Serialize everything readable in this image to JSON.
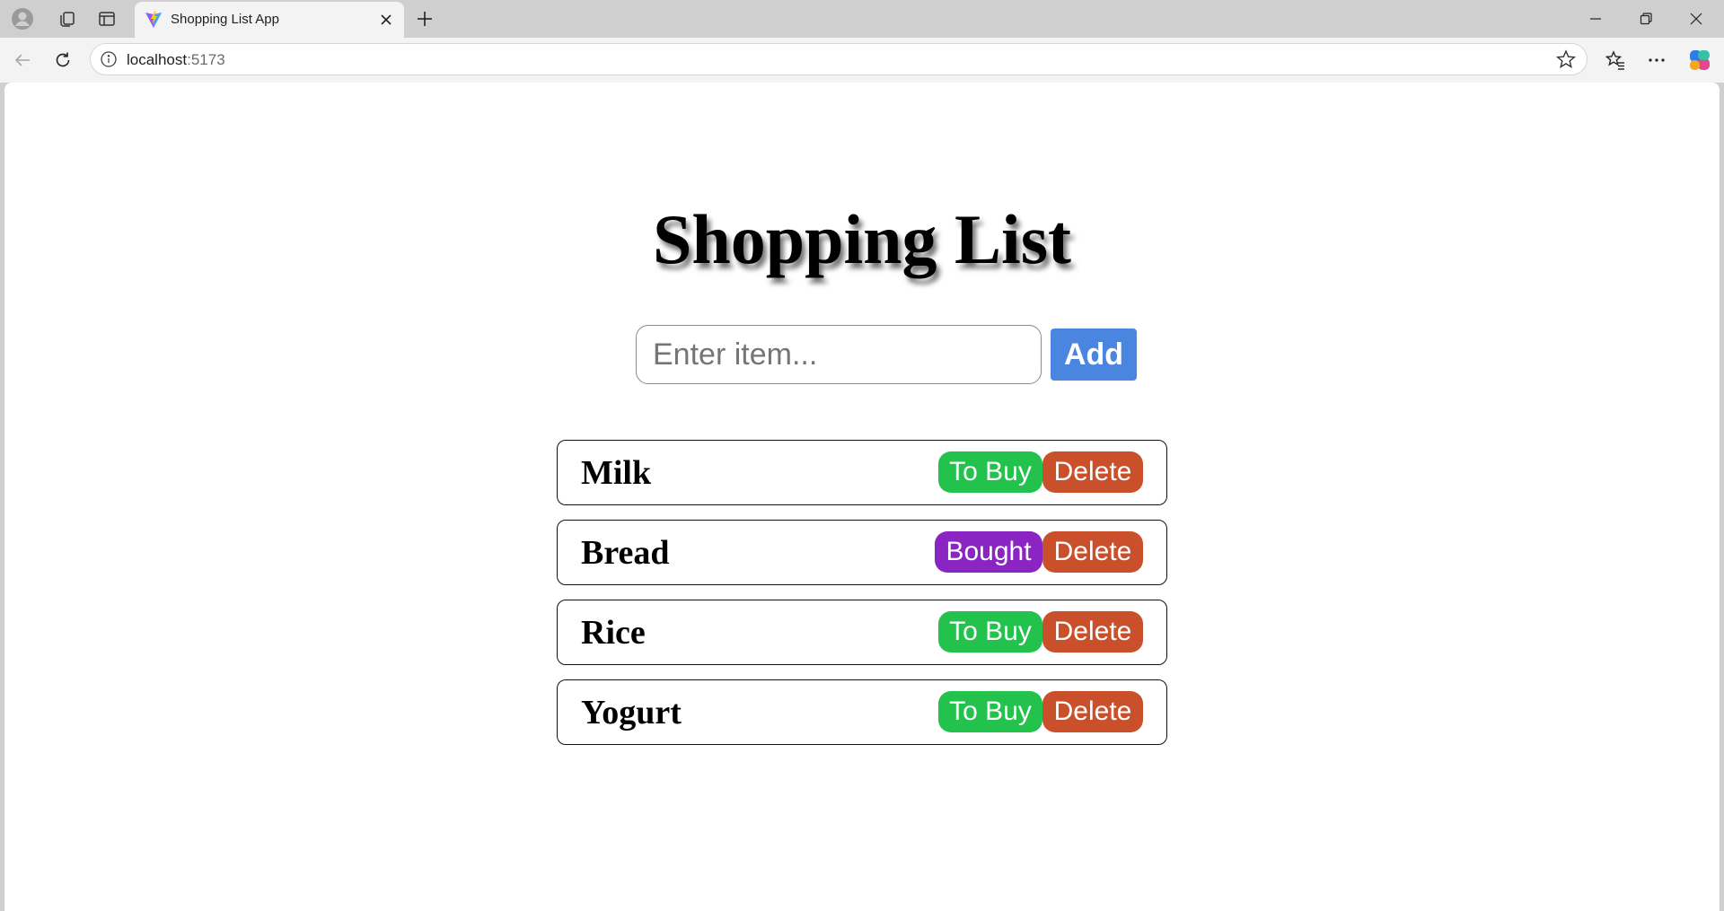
{
  "browser": {
    "tab_title": "Shopping List App",
    "address_host": "localhost",
    "address_port": ":5173"
  },
  "page": {
    "title": "Shopping List",
    "input_placeholder": "Enter item...",
    "input_value": "",
    "add_label": "Add",
    "items": [
      {
        "name": "Milk",
        "status": "To Buy",
        "delete_label": "Delete"
      },
      {
        "name": "Bread",
        "status": "Bought",
        "delete_label": "Delete"
      },
      {
        "name": "Rice",
        "status": "To Buy",
        "delete_label": "Delete"
      },
      {
        "name": "Yogurt",
        "status": "To Buy",
        "delete_label": "Delete"
      }
    ]
  },
  "colors": {
    "add_button": "#4a86e0",
    "to_buy": "#22c24d",
    "bought": "#8a24c2",
    "delete": "#c9502a"
  }
}
